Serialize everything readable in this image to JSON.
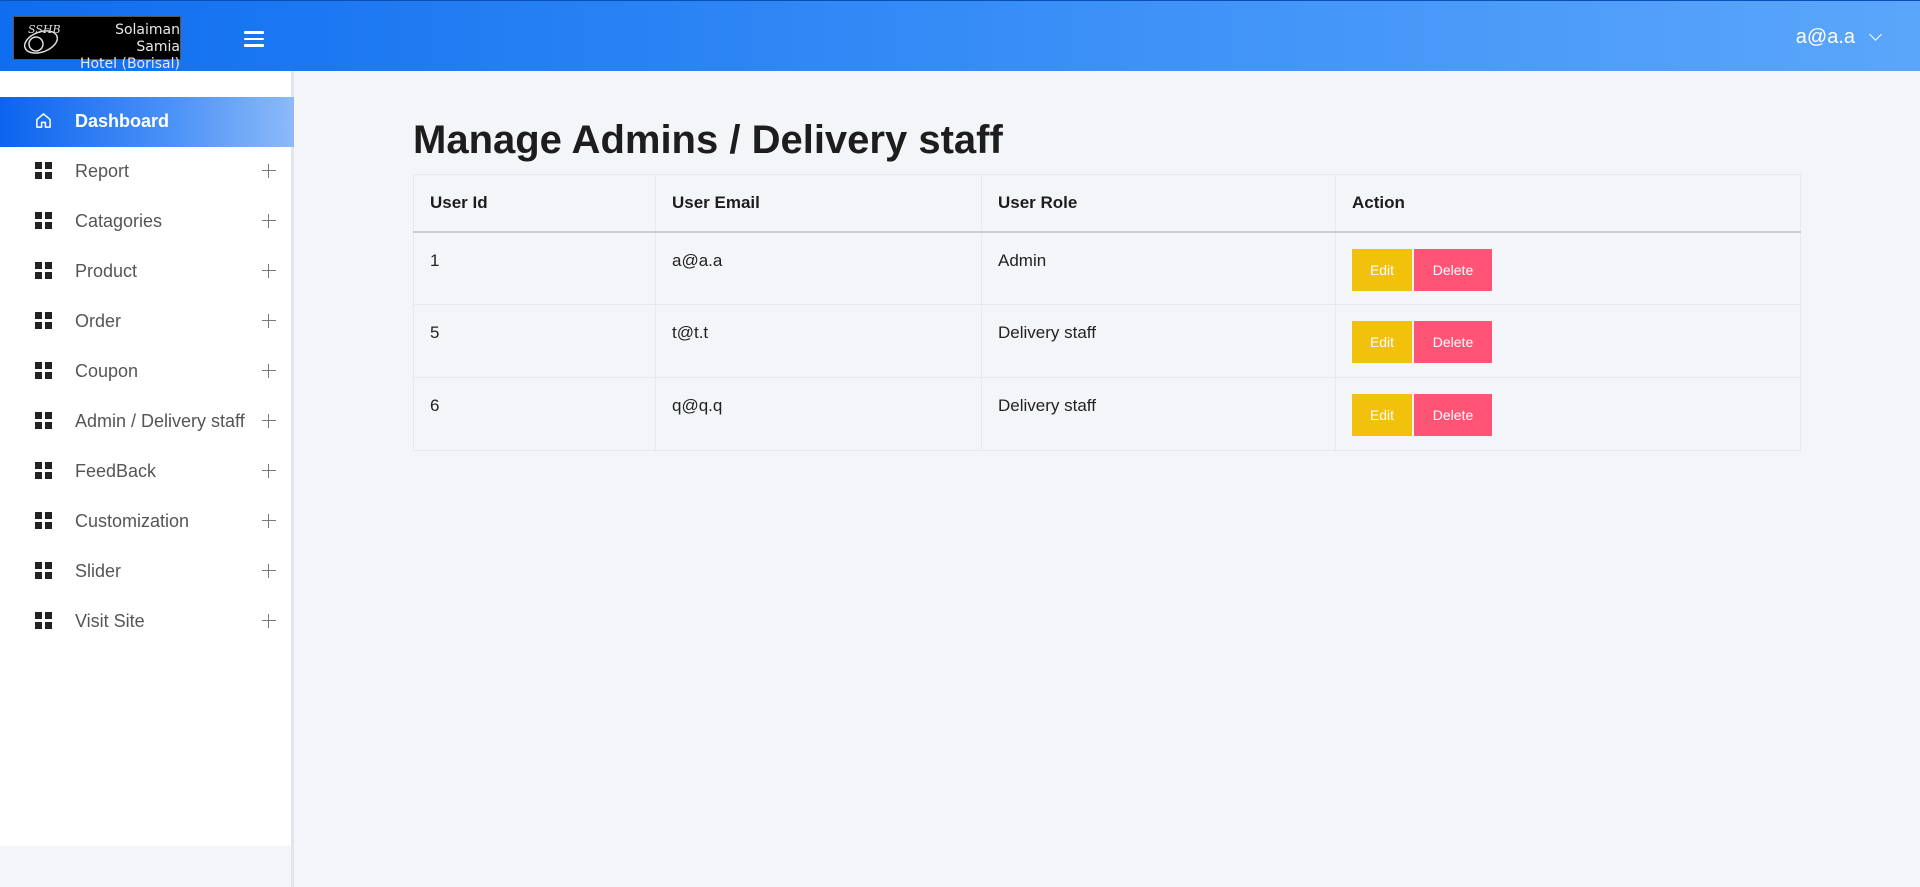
{
  "header": {
    "logo_line1": "Solaiman Samia",
    "logo_line2": "Hotel (Borisal)",
    "logo_mark": "SSHB",
    "user": "a@a.a"
  },
  "sidebar": {
    "items": [
      {
        "label": "Dashboard",
        "icon": "home-icon",
        "active": true
      },
      {
        "label": "Report",
        "icon": "grid-icon"
      },
      {
        "label": "Catagories",
        "icon": "grid-icon"
      },
      {
        "label": "Product",
        "icon": "grid-icon"
      },
      {
        "label": "Order",
        "icon": "grid-icon"
      },
      {
        "label": "Coupon",
        "icon": "grid-icon"
      },
      {
        "label": "Admin / Delivery staff",
        "icon": "grid-icon"
      },
      {
        "label": "FeedBack",
        "icon": "grid-icon"
      },
      {
        "label": "Customization",
        "icon": "grid-icon"
      },
      {
        "label": "Slider",
        "icon": "grid-icon"
      },
      {
        "label": "Visit Site",
        "icon": "grid-icon"
      }
    ]
  },
  "main": {
    "title": "Manage Admins / Delivery staff",
    "table": {
      "headers": [
        "User Id",
        "User Email",
        "User Role",
        "Action"
      ],
      "rows": [
        {
          "id": "1",
          "email": "a@a.a",
          "role": "Admin"
        },
        {
          "id": "5",
          "email": "t@t.t",
          "role": "Delivery staff"
        },
        {
          "id": "6",
          "email": "q@q.q",
          "role": "Delivery staff"
        }
      ],
      "edit_label": "Edit",
      "delete_label": "Delete"
    }
  },
  "colors": {
    "header_gradient_start": "#0f6ef0",
    "header_gradient_end": "#5ba6fb",
    "edit_button": "#f2c10c",
    "delete_button": "#ff5475"
  }
}
